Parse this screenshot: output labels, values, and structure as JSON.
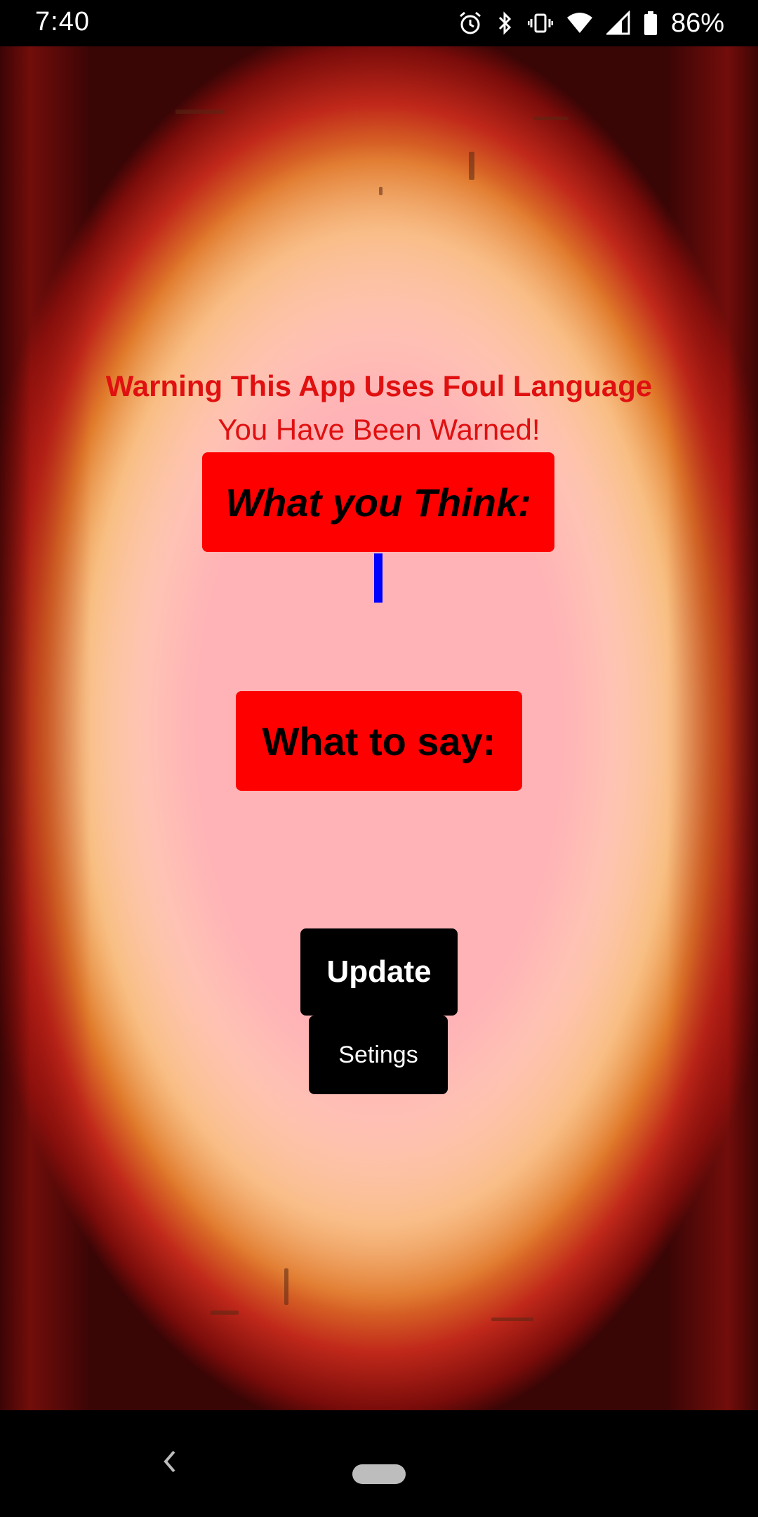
{
  "status_bar": {
    "time": "7:40",
    "battery_percent": "86%",
    "icons": [
      "alarm-icon",
      "bluetooth-icon",
      "vibrate-icon",
      "wifi-icon",
      "cell-signal-icon",
      "battery-icon"
    ]
  },
  "main": {
    "warning_title": "Warning This App Uses Foul Language",
    "warning_subtitle": "You Have Been Warned!",
    "think_label": "What you Think:",
    "say_label": "What to say:",
    "update_button": "Update",
    "settings_button": "Setings"
  },
  "colors": {
    "warning_text": "#e01010",
    "label_box": "#ff0000",
    "cursor": "#0000ff",
    "button_bg": "#000000"
  },
  "nav_bar": {
    "icons": [
      "back-icon",
      "home-pill-icon"
    ]
  }
}
